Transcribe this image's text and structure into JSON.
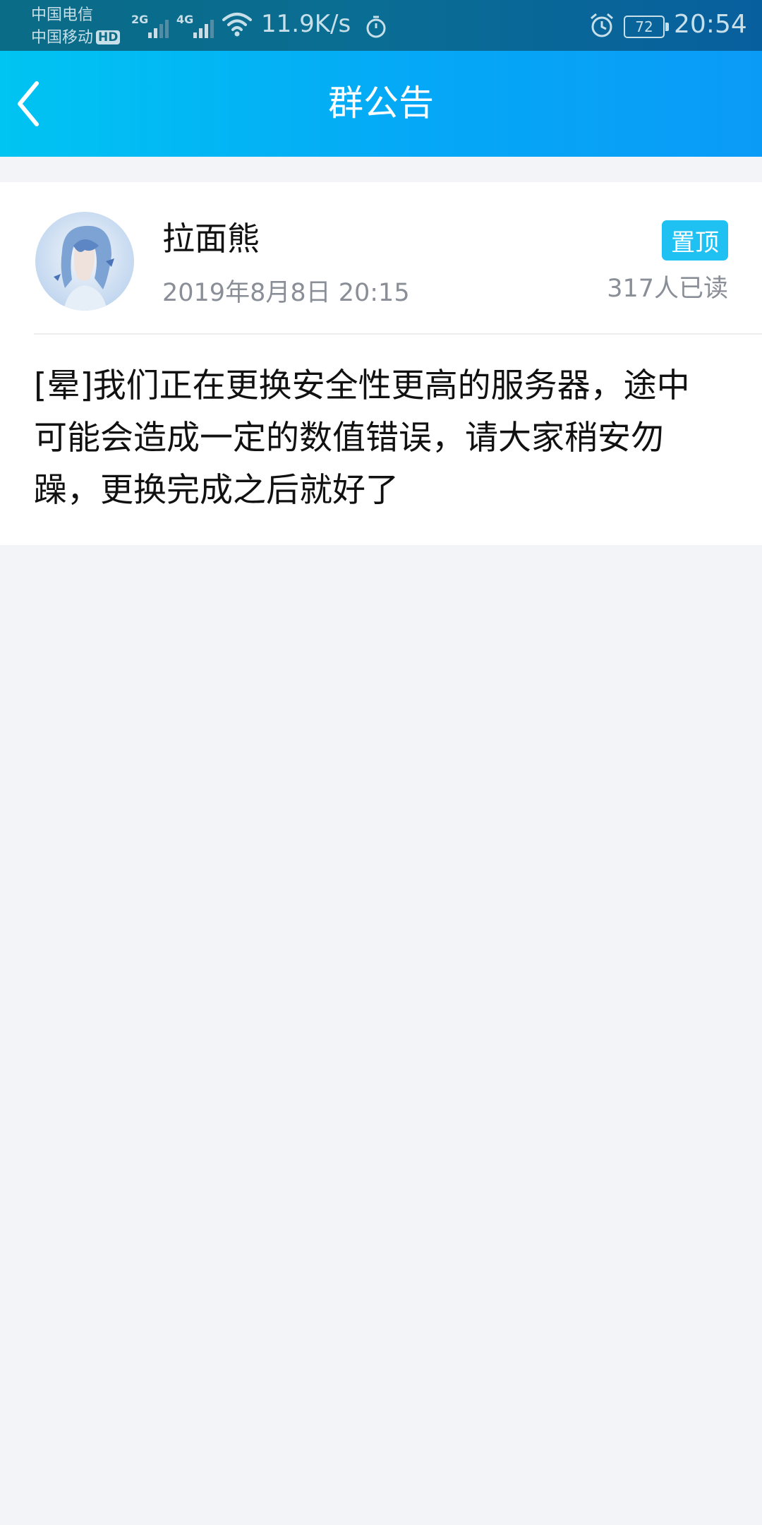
{
  "status_bar": {
    "carrier_1": "中国电信",
    "carrier_2": "中国移动",
    "hd_badge": "HD",
    "signal_1_type": "2G",
    "signal_2_type": "4G",
    "network_speed": "11.9K/s",
    "battery_level": "72",
    "time": "20:54",
    "icons": [
      "wifi-icon",
      "timer-icon",
      "alarm-icon",
      "battery-icon"
    ]
  },
  "header": {
    "title": "群公告",
    "back_icon": "chevron-left-icon",
    "gradient": [
      "#00c4f2",
      "#0a9bf7"
    ]
  },
  "announcement": {
    "author": "拉面熊",
    "date": "2019年8月8日 20:15",
    "pinned_label": "置顶",
    "read_count": "317人已读",
    "content": "[晕]我们正在更换安全性更高的服务器，途中可能会造成一定的数值错误，请大家稍安勿躁，更换完成之后就好了"
  },
  "colors": {
    "accent": "#1fc1f3",
    "background": "#f3f4f8",
    "secondary_text": "#8a8e96"
  }
}
